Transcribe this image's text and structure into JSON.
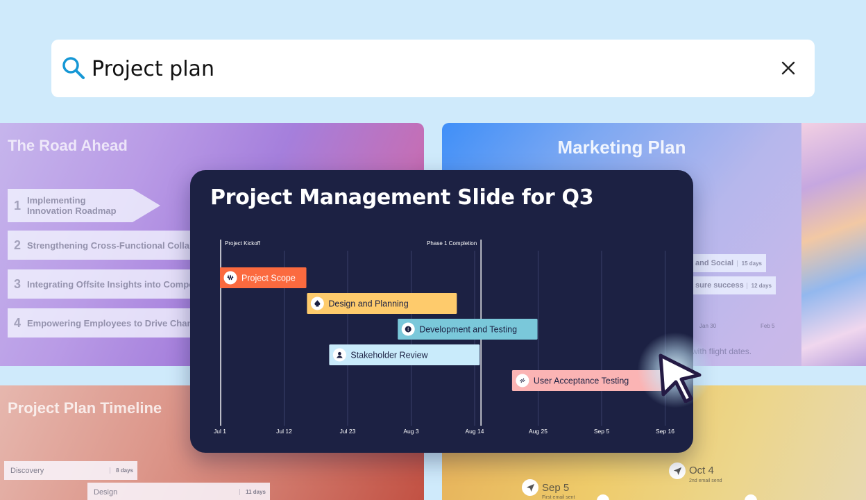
{
  "search": {
    "query": "Project plan"
  },
  "cards": {
    "road": {
      "title": "The Road Ahead",
      "items": [
        {
          "num": "1",
          "label": "Implementing Innovation Roadmap"
        },
        {
          "num": "2",
          "label": "Strengthening Cross-Functional Collab"
        },
        {
          "num": "3",
          "label": "Integrating Offsite Insights into Compo"
        },
        {
          "num": "4",
          "label": "Empowering Employees to Drive Chan"
        }
      ]
    },
    "marketing": {
      "title": "Marketing Plan",
      "rows": [
        {
          "label": "and Social",
          "duration": "15 days"
        },
        {
          "label": "sure success",
          "duration": "12 days"
        }
      ],
      "dates": [
        "Jan 30",
        "Feb 5"
      ],
      "note": "with flight dates."
    },
    "timeline": {
      "title": "Project Plan Timeline",
      "rows": [
        {
          "label": "Discovery",
          "duration": "8 days"
        },
        {
          "label": "Design",
          "duration": "11 days"
        }
      ]
    },
    "email": {
      "milestones": [
        {
          "date": "Sep 5",
          "sub": "First email sent"
        },
        {
          "date": "Oct 4",
          "sub": "2nd email send"
        }
      ]
    }
  },
  "slide": {
    "title": "Project Management Slide for Q3",
    "axis_labels": [
      "Jul 1",
      "Jul 12",
      "Jul 23",
      "Aug 3",
      "Aug 14",
      "Aug 25",
      "Sep 5",
      "Sep 16"
    ],
    "milestones": [
      {
        "label": "Project Kickoff",
        "at": 0
      },
      {
        "label": "Phase 1 Completion",
        "at": 4.1
      }
    ],
    "tasks": [
      {
        "label": "Project Scope",
        "start": 0,
        "end": 1.35,
        "color": "#fb6a3f",
        "text": "#ffffff",
        "icon": "waveform-icon"
      },
      {
        "label": "Design and Planning",
        "start": 1.37,
        "end": 3.72,
        "color": "#fecb6c",
        "text": "#1c2143",
        "icon": "spade-icon"
      },
      {
        "label": "Development and Testing",
        "start": 2.8,
        "end": 4.99,
        "color": "#7ac8da",
        "text": "#1c2143",
        "icon": "globe-icon"
      },
      {
        "label": "Stakeholder Review",
        "start": 1.72,
        "end": 4.08,
        "color": "#c9ebfb",
        "text": "#1c2143",
        "icon": "person-icon"
      },
      {
        "label": "User Acceptance Testing",
        "start": 4.6,
        "end": 7.0,
        "color": "#fbb4b4",
        "text": "#1c2143",
        "icon": "link-icon"
      }
    ],
    "colors": {
      "background": "#1c2143",
      "gridline": "#3a406a"
    }
  }
}
